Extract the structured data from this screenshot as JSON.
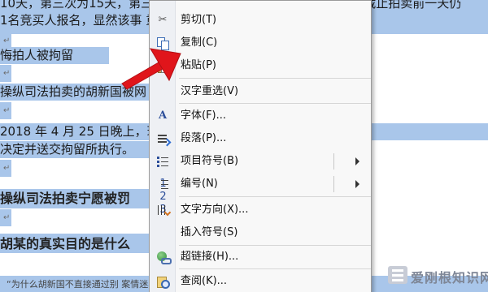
{
  "document": {
    "lines": [
      {
        "text": "10天，第三次为15天，第三次为9天，第四次为7天，而第五次拍卖截止拍卖前一天仍"
      },
      {
        "text": "1名竞买人报名，显然该事                                  重影响了法律的权威"
      },
      {
        "text": "悔拍人被拘留"
      },
      {
        "text": "操纵司法拍卖的胡新国被网"
      },
      {
        "text": "2018 年 4 月 25 日晚上，瑞                                  拍人陈某作出拘留 7 天"
      },
      {
        "text": "决定并送交拘留所执行。"
      },
      {
        "text": "操纵司法拍卖宁愿被罚"
      },
      {
        "text": "胡某的真实目的是什么"
      },
      {
        "text": "“为什么胡新国不直接通过别                                            案情迷雾才散开了。"
      }
    ],
    "para_mark": "↵"
  },
  "context_menu": {
    "items": [
      {
        "label": "剪切(T)",
        "icon": "scissors-icon"
      },
      {
        "label": "复制(C)",
        "icon": "copy-icon"
      },
      {
        "label": "粘贴(P)",
        "icon": "paste-icon"
      },
      {
        "label": "汉字重选(V)",
        "icon": ""
      },
      {
        "label": "字体(F)...",
        "icon": "font-icon"
      },
      {
        "label": "段落(P)...",
        "icon": "paragraph-icon"
      },
      {
        "label": "项目符号(B)",
        "icon": "bullets-icon",
        "submenu": true
      },
      {
        "label": "编号(N)",
        "icon": "numbering-icon",
        "submenu": true
      },
      {
        "label": "文字方向(X)...",
        "icon": "text-direction-icon"
      },
      {
        "label": "插入符号(S)",
        "icon": ""
      },
      {
        "label": "超链接(H)...",
        "icon": "hyperlink-icon"
      },
      {
        "label": "查阅(K)...",
        "icon": "lookup-icon"
      }
    ]
  },
  "annotation": {
    "arrow_color": "#e0151b",
    "points_to": "复制(C)"
  },
  "watermark": {
    "text": "爱刚根知识网"
  },
  "colors": {
    "selection": "#a9c6ea",
    "menu_bg": "#f8f8f8"
  }
}
